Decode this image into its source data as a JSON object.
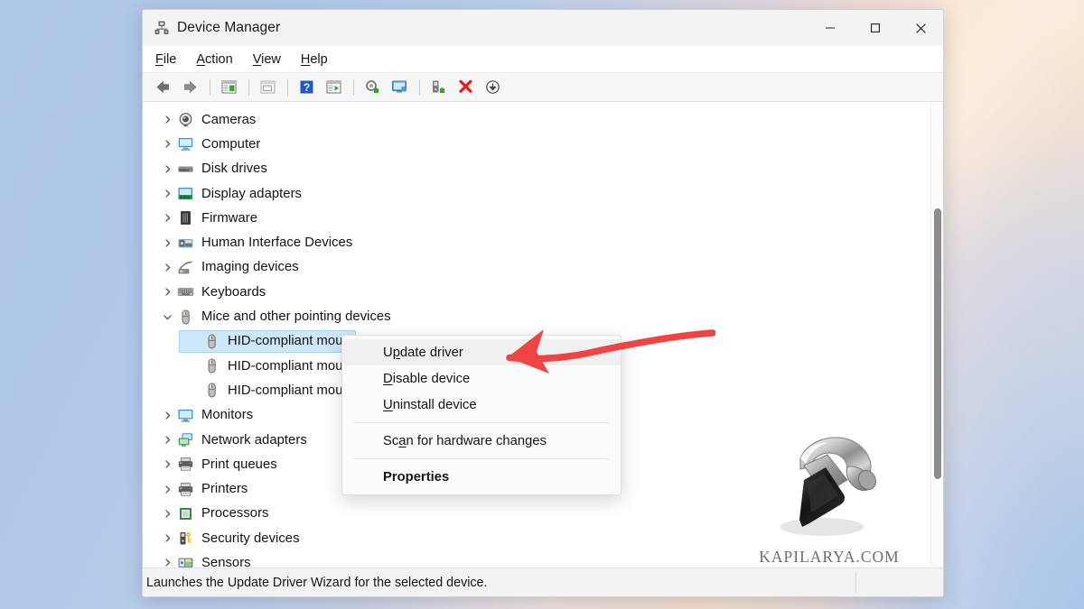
{
  "window": {
    "title": "Device Manager",
    "title_icon": "device-manager-icon",
    "controls": {
      "minimize": "minimize-icon",
      "maximize": "maximize-icon",
      "close": "close-icon"
    }
  },
  "menubar": {
    "items": [
      {
        "label": "File",
        "accel": "F"
      },
      {
        "label": "Action",
        "accel": "A"
      },
      {
        "label": "View",
        "accel": "V"
      },
      {
        "label": "Help",
        "accel": "H"
      }
    ]
  },
  "toolbar": {
    "buttons": [
      {
        "name": "back-icon"
      },
      {
        "name": "forward-icon"
      },
      {
        "name": "show-hide-console-tree-icon"
      },
      {
        "name": "properties-icon"
      },
      {
        "name": "help-icon"
      },
      {
        "name": "view-icon"
      },
      {
        "name": "update-driver-icon"
      },
      {
        "name": "scan-for-hardware-changes-icon"
      },
      {
        "name": "enable-device-icon"
      },
      {
        "name": "uninstall-device-icon"
      },
      {
        "name": "disable-device-icon"
      }
    ]
  },
  "tree": {
    "nodes": [
      {
        "label": "Cameras",
        "icon": "camera-icon",
        "expanded": false,
        "child": false,
        "selected": false
      },
      {
        "label": "Computer",
        "icon": "computer-icon",
        "expanded": false,
        "child": false,
        "selected": false
      },
      {
        "label": "Disk drives",
        "icon": "disk-drive-icon",
        "expanded": false,
        "child": false,
        "selected": false
      },
      {
        "label": "Display adapters",
        "icon": "display-adapter-icon",
        "expanded": false,
        "child": false,
        "selected": false
      },
      {
        "label": "Firmware",
        "icon": "firmware-icon",
        "expanded": false,
        "child": false,
        "selected": false
      },
      {
        "label": "Human Interface Devices",
        "icon": "hid-icon",
        "expanded": false,
        "child": false,
        "selected": false
      },
      {
        "label": "Imaging devices",
        "icon": "imaging-device-icon",
        "expanded": false,
        "child": false,
        "selected": false
      },
      {
        "label": "Keyboards",
        "icon": "keyboard-icon",
        "expanded": false,
        "child": false,
        "selected": false
      },
      {
        "label": "Mice and other pointing devices",
        "icon": "mouse-icon",
        "expanded": true,
        "child": false,
        "selected": false
      },
      {
        "label": "HID-compliant mouse",
        "icon": "mouse-icon",
        "expanded": null,
        "child": true,
        "selected": true
      },
      {
        "label": "HID-compliant mouse",
        "icon": "mouse-icon",
        "expanded": null,
        "child": true,
        "selected": false
      },
      {
        "label": "HID-compliant mouse",
        "icon": "mouse-icon",
        "expanded": null,
        "child": true,
        "selected": false
      },
      {
        "label": "Monitors",
        "icon": "monitor-icon",
        "expanded": false,
        "child": false,
        "selected": false
      },
      {
        "label": "Network adapters",
        "icon": "network-adapter-icon",
        "expanded": false,
        "child": false,
        "selected": false
      },
      {
        "label": "Print queues",
        "icon": "printer-icon",
        "expanded": false,
        "child": false,
        "selected": false
      },
      {
        "label": "Printers",
        "icon": "printer-icon",
        "expanded": false,
        "child": false,
        "selected": false
      },
      {
        "label": "Processors",
        "icon": "processor-icon",
        "expanded": false,
        "child": false,
        "selected": false
      },
      {
        "label": "Security devices",
        "icon": "security-device-icon",
        "expanded": false,
        "child": false,
        "selected": false
      },
      {
        "label": "Sensors",
        "icon": "sensor-icon",
        "expanded": false,
        "child": false,
        "selected": false
      }
    ]
  },
  "context_menu": {
    "items": [
      {
        "label": "Update driver",
        "accel": "p",
        "hover": true,
        "bold": false,
        "sep_after": false
      },
      {
        "label": "Disable device",
        "accel": "D",
        "hover": false,
        "bold": false,
        "sep_after": false
      },
      {
        "label": "Uninstall device",
        "accel": "U",
        "hover": false,
        "bold": false,
        "sep_after": true
      },
      {
        "label": "Scan for hardware changes",
        "accel": "a",
        "hover": false,
        "bold": false,
        "sep_after": true
      },
      {
        "label": "Properties",
        "accel": "R",
        "hover": false,
        "bold": true,
        "sep_after": false
      }
    ]
  },
  "statusbar": {
    "text": "Launches the Update Driver Wizard for the selected device."
  },
  "annotation": {
    "arrow_color": "#ee4444",
    "arrow_points_to": "Update driver"
  },
  "watermark": {
    "text": "KAPILARYA.COM",
    "icon": "hammer-icon"
  },
  "colors": {
    "selection": "#cde8f9",
    "selection_border": "#a8d4ef",
    "menu_hover": "#f0f0f0",
    "accent_red": "#ee4444",
    "window_chrome": "#f3f3f3"
  }
}
